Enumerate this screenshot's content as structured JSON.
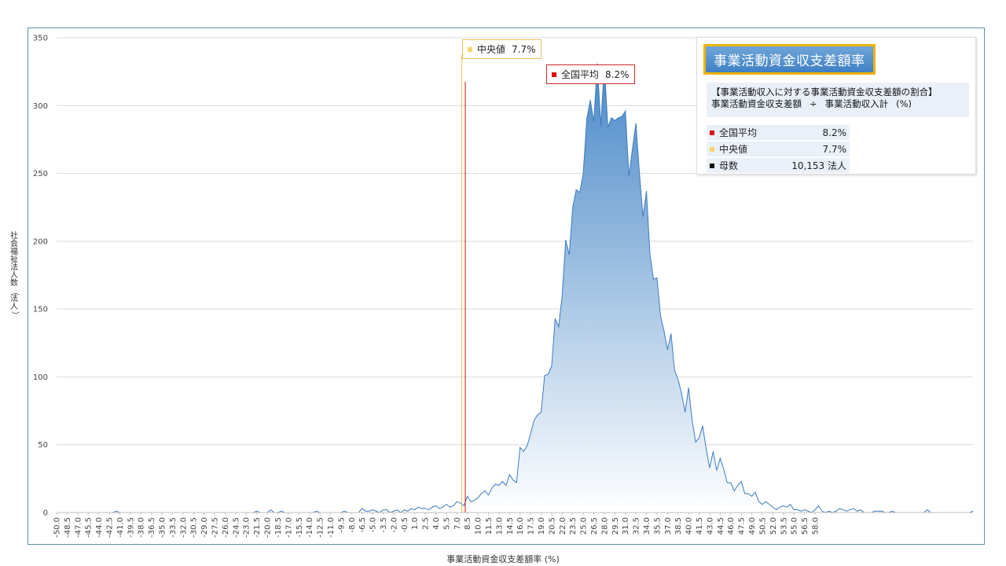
{
  "chart_data": {
    "type": "area",
    "title": "事業活動資金収支差額率",
    "xlabel": "事業活動資金収支差額率 (%)",
    "ylabel": "社会福祉法人数（法人）",
    "ylim": [
      0,
      350
    ],
    "y_ticks": [
      "0",
      "50",
      "100",
      "150",
      "200",
      "250",
      "300",
      "350"
    ],
    "x_tick_labels": [
      "-50.0",
      "-48.5",
      "-47.0",
      "-45.5",
      "-44.0",
      "-42.5",
      "-41.0",
      "-39.5",
      "-38.0",
      "-36.5",
      "-35.0",
      "-33.5",
      "-32.0",
      "-30.5",
      "-29.0",
      "-27.5",
      "-26.0",
      "-24.5",
      "-23.0",
      "-21.5",
      "-20.0",
      "-18.5",
      "-17.0",
      "-15.5",
      "-14.0",
      "-12.5",
      "-11.0",
      "-9.5",
      "-8.0",
      "-6.5",
      "-5.0",
      "-3.5",
      "-2.0",
      "-0.5",
      "1.0",
      "2.5",
      "4.0",
      "5.5",
      "7.0",
      "8.5",
      "10.0",
      "11.5",
      "13.0",
      "14.5",
      "16.0",
      "17.5",
      "19.0",
      "20.5",
      "22.0",
      "23.5",
      "25.0",
      "26.5",
      "28.0",
      "29.5",
      "31.0",
      "32.5",
      "34.0",
      "35.5",
      "37.0",
      "38.5",
      "40.0",
      "41.5",
      "43.0",
      "44.5",
      "46.0",
      "47.5",
      "49.0",
      "50.5",
      "52.0",
      "53.5",
      "55.0",
      "56.5",
      "58.0"
    ],
    "x_start": -50.0,
    "x_step": 0.5,
    "series": [
      {
        "values": [
          0,
          0,
          0,
          0,
          0,
          0,
          0,
          0,
          0,
          0,
          0,
          0,
          0,
          0,
          0,
          0,
          0,
          1,
          0,
          0,
          0,
          0,
          0,
          0,
          0,
          0,
          0,
          0,
          0,
          0,
          0,
          0,
          0,
          0,
          0,
          0,
          0,
          0,
          0,
          0,
          0,
          0,
          0,
          0,
          0,
          0,
          0,
          0,
          0,
          0,
          0,
          0,
          0,
          0,
          0,
          0,
          0,
          1,
          0,
          0,
          0,
          2,
          0,
          0,
          1,
          0,
          0,
          0,
          0,
          0,
          0,
          0,
          0,
          0,
          1,
          0,
          0,
          0,
          0,
          0,
          0,
          0,
          1,
          0,
          0,
          0,
          0,
          3,
          1,
          1,
          2,
          1,
          0,
          2,
          2,
          0,
          1,
          2,
          0,
          2,
          1,
          3,
          2,
          4,
          3,
          3,
          2,
          4,
          5,
          3,
          4,
          6,
          4,
          5,
          8,
          7,
          5,
          12,
          8,
          9,
          11,
          14,
          16,
          13,
          18,
          21,
          20,
          23,
          20,
          28,
          24,
          22,
          48,
          45,
          49,
          58,
          68,
          72,
          74,
          101,
          102,
          108,
          143,
          137,
          160,
          201,
          190,
          225,
          238,
          236,
          250,
          290,
          304,
          288,
          331,
          285,
          330,
          284,
          291,
          289,
          291,
          292,
          296,
          248,
          268,
          287,
          250,
          218,
          237,
          190,
          172,
          173,
          145,
          134,
          120,
          132,
          105,
          98,
          88,
          74,
          92,
          68,
          52,
          55,
          64,
          47,
          33,
          45,
          31,
          40,
          32,
          22,
          22,
          16,
          20,
          23,
          14,
          14,
          12,
          15,
          8,
          6,
          8,
          6,
          4,
          2,
          4,
          5,
          4,
          6,
          2,
          2,
          1,
          2,
          1,
          0,
          2,
          5,
          1,
          0,
          1,
          0,
          1,
          3,
          2,
          1,
          2,
          3,
          1,
          2,
          0,
          0,
          0,
          1,
          1,
          1,
          0,
          0,
          1,
          0,
          0,
          0,
          0,
          0,
          0,
          0,
          0,
          0,
          2,
          0,
          0,
          0,
          0,
          0,
          0,
          0,
          0,
          0,
          0,
          0,
          0,
          1
        ]
      }
    ],
    "mean": 8.2,
    "median": 7.7
  },
  "callouts": {
    "median": {
      "label": "中央値",
      "value": "7.7%"
    },
    "mean": {
      "label": "全国平均",
      "value": "8.2%"
    }
  },
  "info_panel": {
    "title": "事業活動資金収支差額率",
    "formula_line1": "【事業活動収入に対する事業活動資金収支差額の割合】",
    "formula_numerator": "事業活動資金収支差額",
    "formula_operator": "÷",
    "formula_denominator": "事業活動収入計",
    "formula_unit": "(%)",
    "rows": [
      {
        "label": "全国平均",
        "value": "8.2%",
        "color": "#e01010"
      },
      {
        "label": "中央値",
        "value": "7.7%",
        "color": "#f7d36b"
      },
      {
        "label": "母数",
        "value": "10,153  法人",
        "color": "#111111"
      }
    ]
  },
  "colors": {
    "area_top": "#4a89c8",
    "area_bottom": "#ffffff",
    "line": "#3d7cc0",
    "mean_line": "#d01010",
    "median_line": "#f0c15a",
    "grid": "#d9d9d9"
  }
}
